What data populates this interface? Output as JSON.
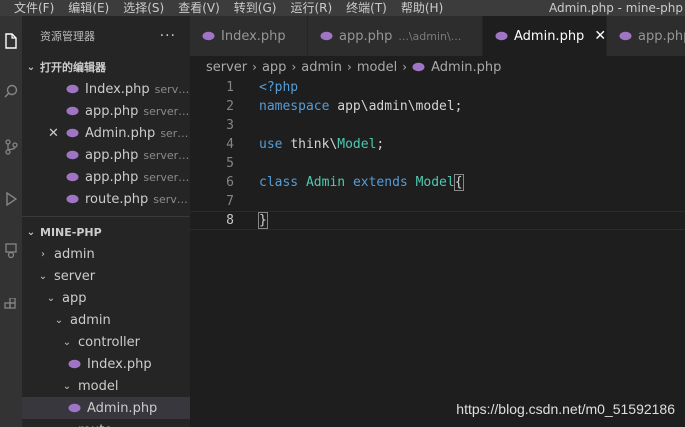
{
  "menu": [
    "文件(F)",
    "编辑(E)",
    "选择(S)",
    "查看(V)",
    "转到(G)",
    "运行(R)",
    "终端(T)",
    "帮助(H)"
  ],
  "window_title": "Admin.php - mine-php",
  "sidebar": {
    "title": "资源管理器",
    "more": "···",
    "open_editors_header": "打开的编辑器",
    "open_editors": [
      {
        "label": "Index.php",
        "desc": "server..."
      },
      {
        "label": "app.php",
        "desc": "server\\a..."
      },
      {
        "label": "Admin.php",
        "desc": "serve..."
      },
      {
        "label": "app.php",
        "desc": "server\\r..."
      },
      {
        "label": "app.php",
        "desc": "server\\a..."
      },
      {
        "label": "route.php",
        "desc": "server..."
      }
    ],
    "project_header": "MINE-PHP",
    "tree": [
      {
        "label": "admin"
      },
      {
        "label": "server"
      },
      {
        "label": "app"
      },
      {
        "label": "admin"
      },
      {
        "label": "controller"
      },
      {
        "label": "Index.php"
      },
      {
        "label": "model"
      },
      {
        "label": "Admin.php"
      },
      {
        "label": "route"
      }
    ]
  },
  "tabs": [
    {
      "label": "Index.php",
      "desc": ""
    },
    {
      "label": "app.php",
      "desc": "...\\admin\\..."
    },
    {
      "label": "Admin.php",
      "desc": "",
      "close": "✕"
    },
    {
      "label": "app.php",
      "desc": ""
    }
  ],
  "breadcrumb": [
    "server",
    "app",
    "admin",
    "model",
    "Admin.php"
  ],
  "code": {
    "line_numbers": [
      "1",
      "2",
      "3",
      "4",
      "5",
      "6",
      "7",
      "8"
    ],
    "l1": "<?php",
    "l2_kw": "namespace",
    "l2_ns": "app\\admin\\model;",
    "l4_kw": "use",
    "l4_ns1": "think",
    "l4_sep": "\\",
    "l4_ns2": "Model",
    "l4_end": ";",
    "l6_kw": "class",
    "l6_name": "Admin",
    "l6_ext": "extends",
    "l6_parent": "Model",
    "l6_brace": "{",
    "l8_brace": "}"
  },
  "watermark": "https://blog.csdn.net/m0_51592186",
  "colors": {
    "php_icon": "#a074c4",
    "keyword": "#569cd6",
    "type": "#4ec9b0"
  }
}
